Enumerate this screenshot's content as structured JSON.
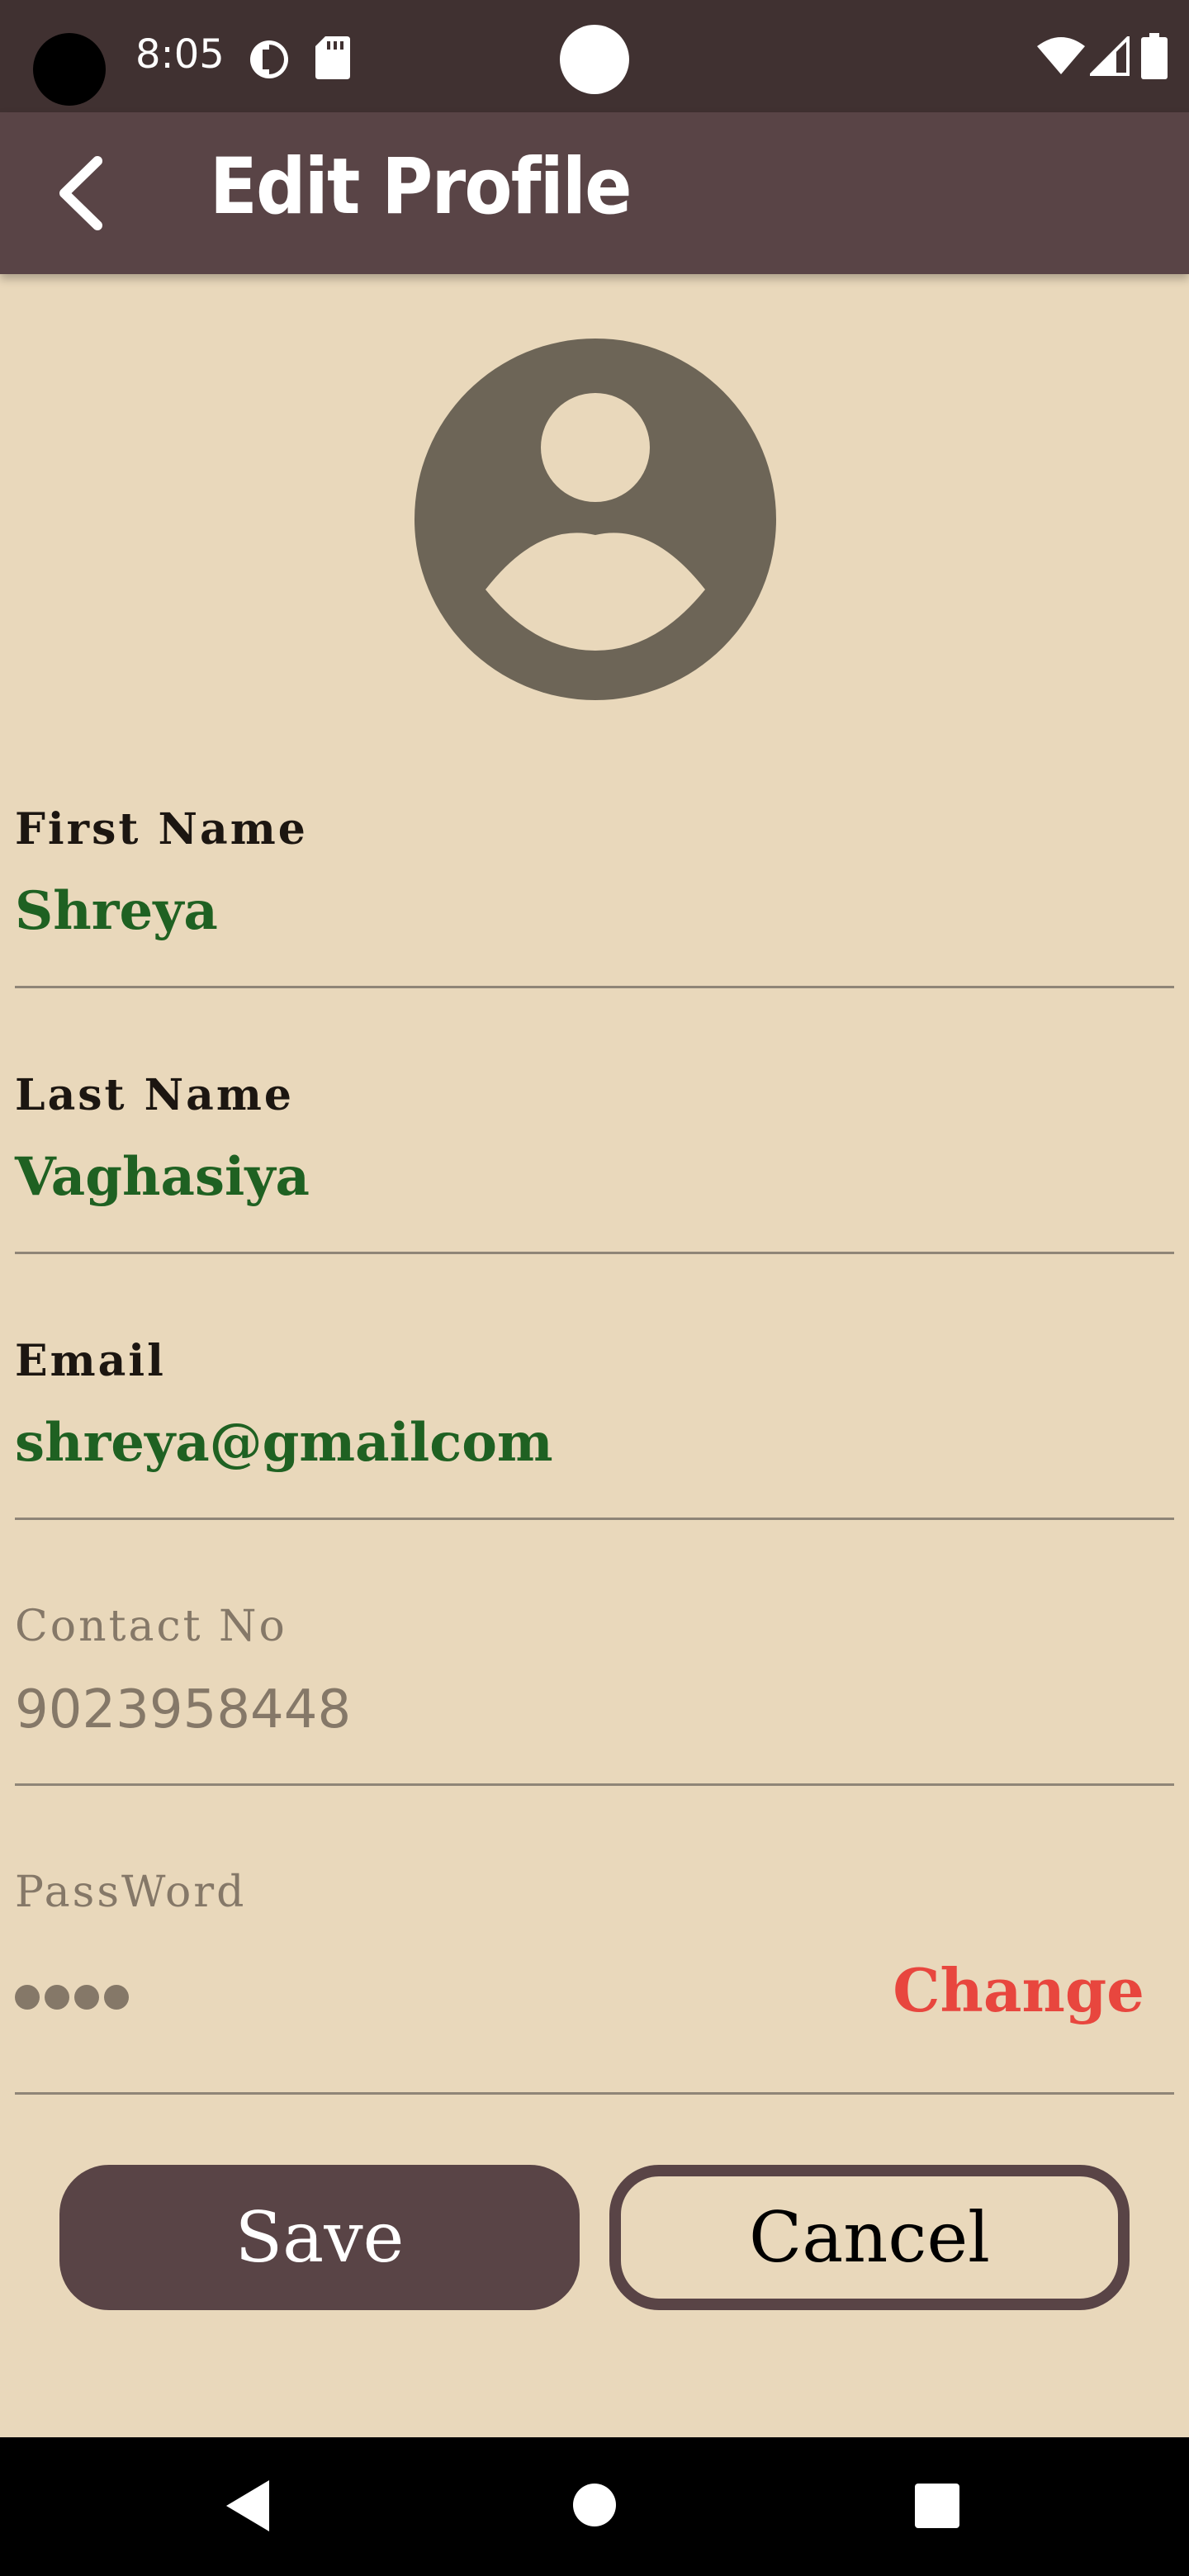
{
  "status_bar": {
    "time": "8:05"
  },
  "toolbar": {
    "title": "Edit Profile",
    "back_icon": "back-arrow-icon"
  },
  "avatar": {
    "icon": "user-avatar-icon"
  },
  "fields": {
    "first_name": {
      "label": "First Name",
      "value": "Shreya"
    },
    "last_name": {
      "label": "Last Name",
      "value": "Vaghasiya"
    },
    "email": {
      "label": "Email",
      "value": "shreya@gmailcom"
    },
    "contact": {
      "label": "Contact No",
      "value": "9023958448"
    },
    "password": {
      "label": "PassWord",
      "masked_length": 4,
      "change_label": "Change"
    }
  },
  "actions": {
    "save_label": "Save",
    "cancel_label": "Cancel"
  },
  "colors": {
    "background": "#E9D8BB",
    "toolbar": "#594446",
    "status_bar": "#403131",
    "value_text": "#1F6122",
    "disabled_text": "#857868",
    "change_link": "#E8463E"
  }
}
